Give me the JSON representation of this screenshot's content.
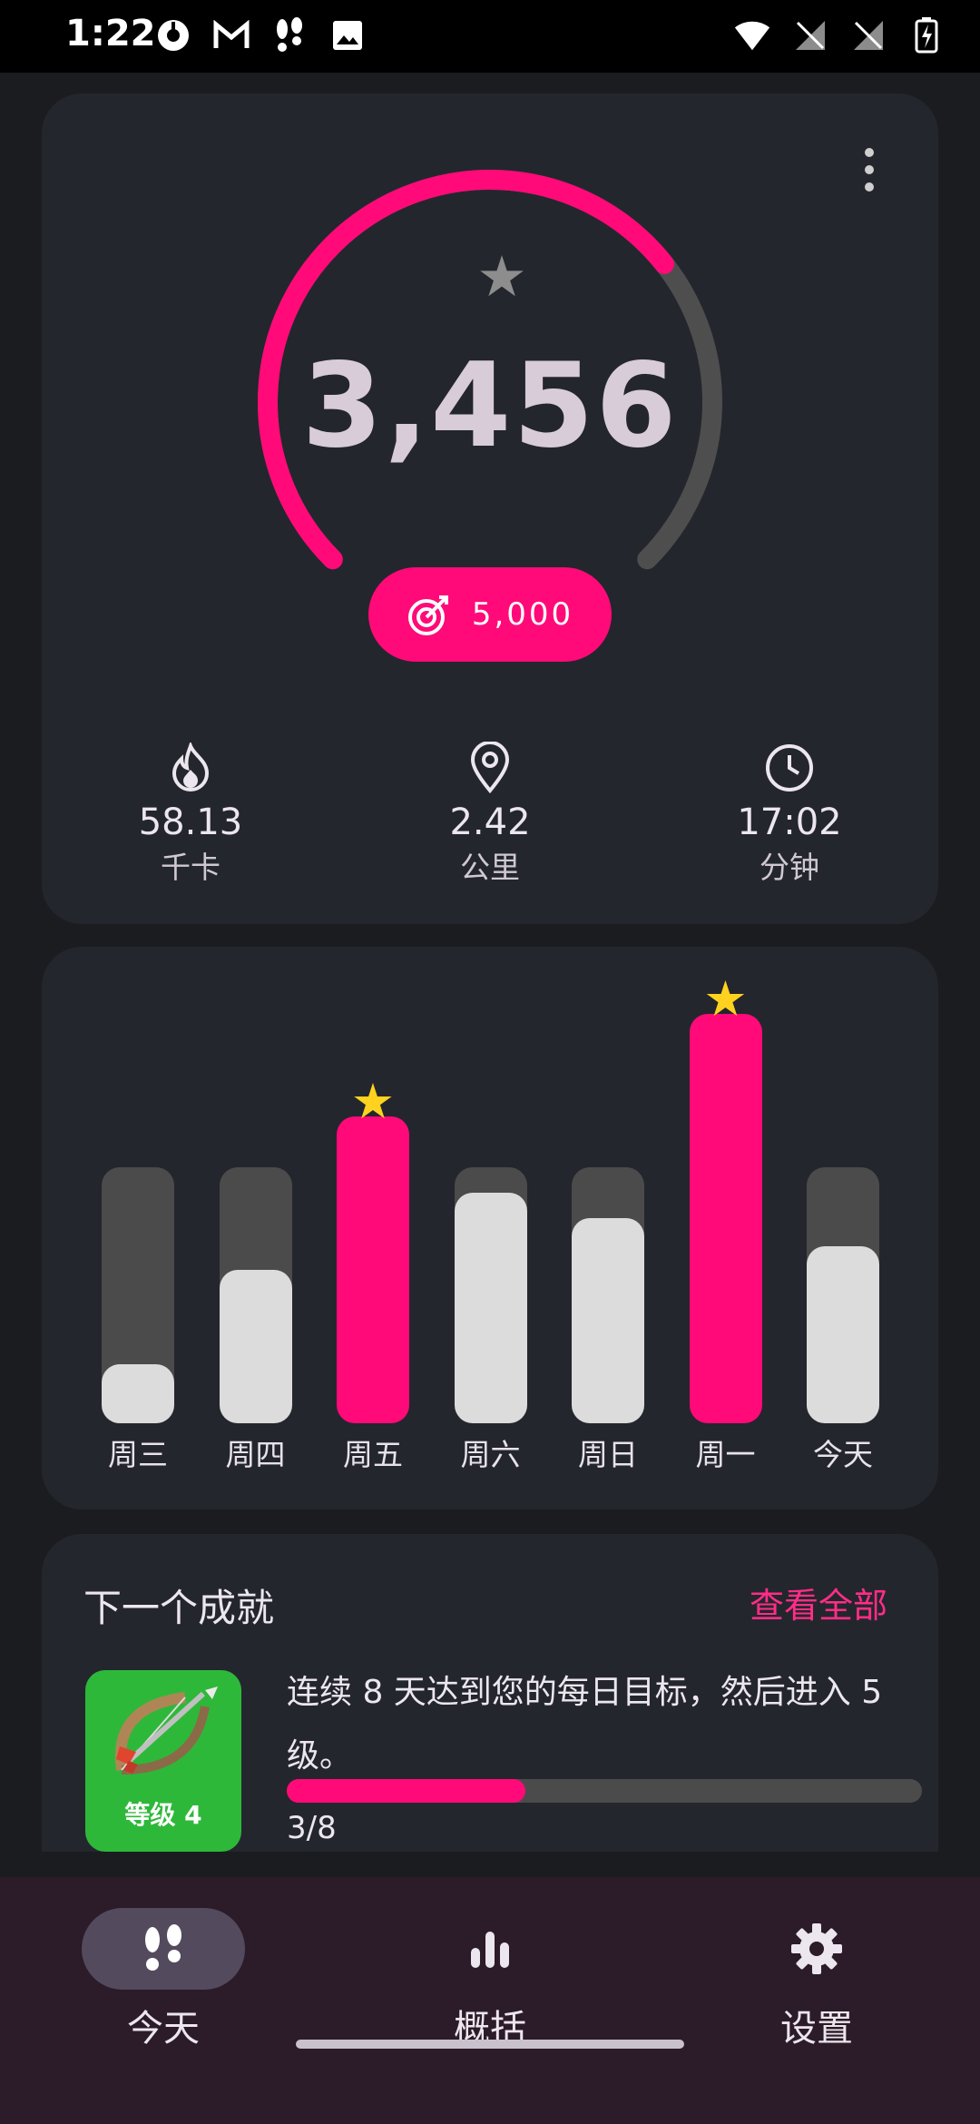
{
  "status_bar": {
    "time": "1:22",
    "left_icons": [
      "app-icon",
      "gmail-icon",
      "footsteps-icon",
      "image-icon"
    ],
    "right_icons": [
      "wifi-icon",
      "no-sim-icon",
      "no-sim-icon",
      "battery-charging-icon"
    ]
  },
  "steps_card": {
    "steps": "3,456",
    "goal": "5,000",
    "progress_fraction": 0.6912,
    "menu_icon": "more-vert-icon",
    "star_icon": "star-icon",
    "stats": [
      {
        "icon": "flame-icon",
        "value": "58.13",
        "unit": "千卡"
      },
      {
        "icon": "location-pin-icon",
        "value": "2.42",
        "unit": "公里"
      },
      {
        "icon": "clock-icon",
        "value": "17:02",
        "unit": "分钟"
      }
    ]
  },
  "week_chart": {
    "days": [
      {
        "label": "周三",
        "fraction": 0.23,
        "goal_reached": false
      },
      {
        "label": "周四",
        "fraction": 0.6,
        "goal_reached": false
      },
      {
        "label": "周五",
        "fraction": 1.2,
        "goal_reached": true
      },
      {
        "label": "周六",
        "fraction": 0.9,
        "goal_reached": false
      },
      {
        "label": "周日",
        "fraction": 0.8,
        "goal_reached": false
      },
      {
        "label": "周一",
        "fraction": 1.6,
        "goal_reached": true
      },
      {
        "label": "今天",
        "fraction": 0.69,
        "goal_reached": false
      }
    ],
    "colors": {
      "goal": "#ff0a78",
      "normal": "#dcdcdc",
      "track": "#4b4b4b",
      "star": "#ffd21f"
    }
  },
  "achievement": {
    "title": "下一个成就",
    "view_all": "查看全部",
    "badge_level": "等级 4",
    "badge_icon": "bow-and-arrow-icon",
    "description": "连续 8 天达到您的每日目标，然后进入 5 级。",
    "progress_text": "3/8",
    "progress_fraction": 0.375
  },
  "nav": {
    "items": [
      {
        "label": "今天",
        "icon": "footsteps-icon",
        "active": true
      },
      {
        "label": "概括",
        "icon": "bar-chart-icon",
        "active": false
      },
      {
        "label": "设置",
        "icon": "gear-icon",
        "active": false
      }
    ]
  },
  "accent_color": "#ff0a78"
}
